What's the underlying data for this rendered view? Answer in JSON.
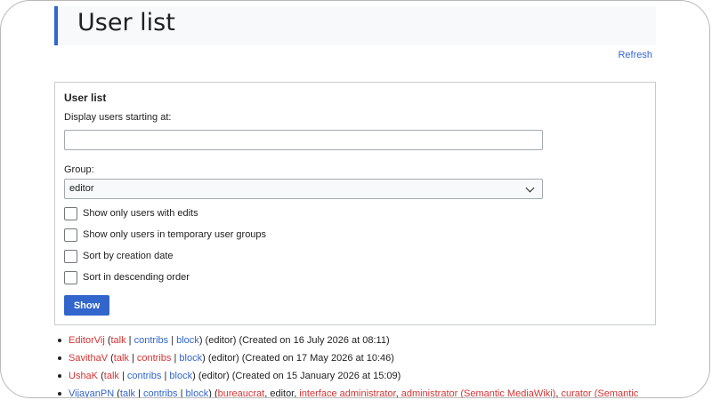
{
  "page": {
    "title": "User list",
    "refresh_label": "Refresh"
  },
  "form": {
    "legend": "User list",
    "start_label": "Display users starting at:",
    "start_value": "",
    "group_label": "Group:",
    "group_value": "editor",
    "checkboxes": [
      {
        "label": "Show only users with edits",
        "checked": false
      },
      {
        "label": "Show only users in temporary user groups",
        "checked": false
      },
      {
        "label": "Sort by creation date",
        "checked": false
      },
      {
        "label": "Sort in descending order",
        "checked": false
      }
    ],
    "show_label": "Show"
  },
  "links": {
    "talk": "talk",
    "contribs": "contribs",
    "block": "block"
  },
  "users": [
    {
      "name": "EditorVij",
      "groups": "(editor) (Created on 16 July 2026 at 08:11)"
    },
    {
      "name": "SavithaV",
      "groups": "(editor) (Created on 17 May 2026 at 10:46)"
    },
    {
      "name": "UshaK",
      "groups": "(editor) (Created on 15 January 2026 at 15:09)"
    },
    {
      "name": "VijayanPN",
      "group_bureaucrat": "bureaucrat",
      "group_editor": "editor",
      "group_interface_admin": "interface administrator",
      "group_admin_smw": "administrator (Semantic MediaWiki)",
      "group_curator": "curator (Semantic"
    }
  ],
  "colors": {
    "accent": "#3366cc",
    "redlink": "#d73333"
  }
}
